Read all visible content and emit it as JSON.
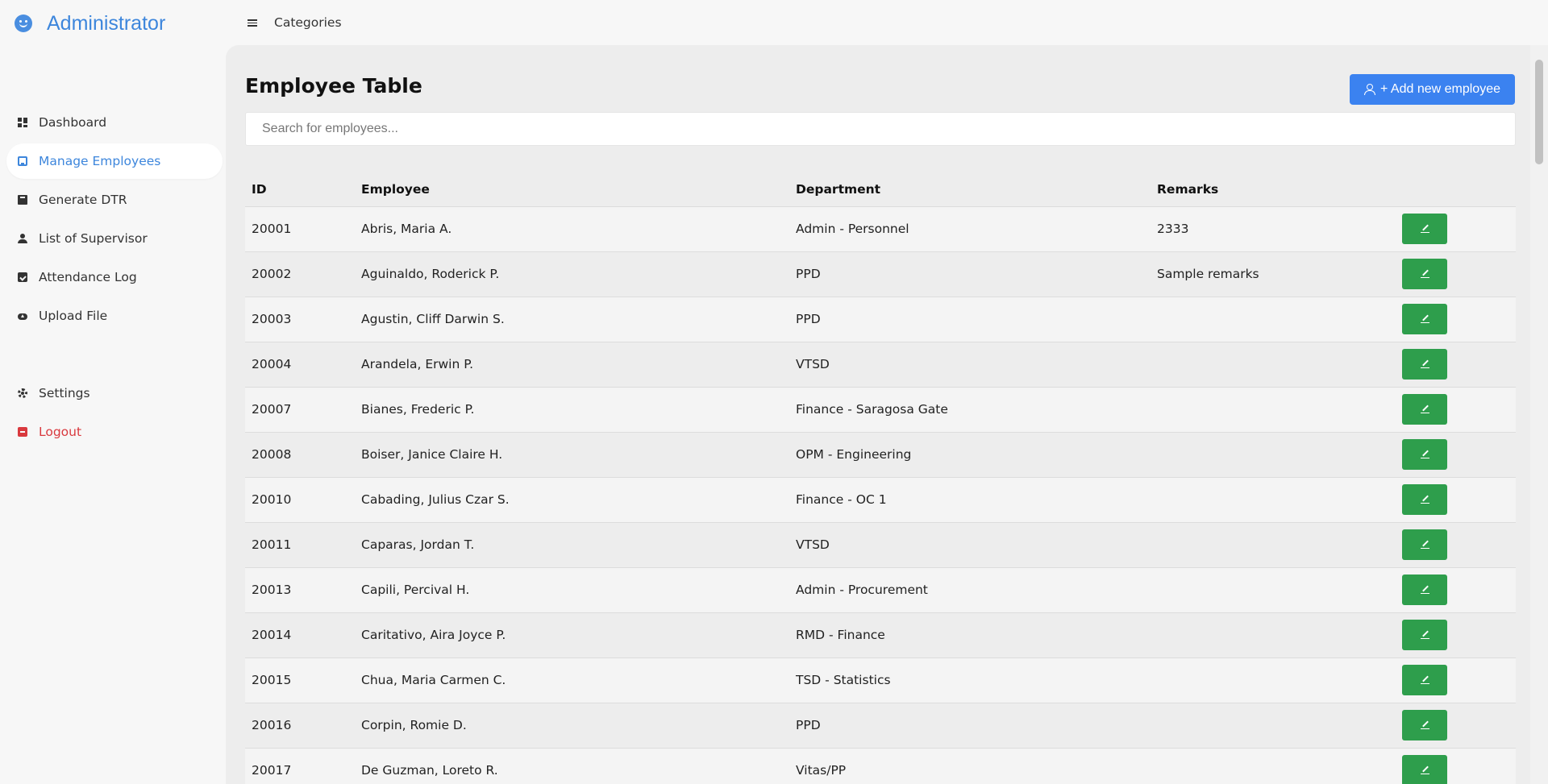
{
  "brand": {
    "title": "Administrator",
    "icon": "smiley-icon"
  },
  "topbar": {
    "title": "Categories",
    "menu_icon": "hamburger-icon"
  },
  "sidebar": {
    "items": [
      {
        "label": "Dashboard",
        "icon": "dashboard-icon",
        "active": false
      },
      {
        "label": "Manage Employees",
        "icon": "manage-employees-icon",
        "active": true
      },
      {
        "label": "Generate DTR",
        "icon": "book-icon",
        "active": false
      },
      {
        "label": "List of Supervisor",
        "icon": "user-icon",
        "active": false
      },
      {
        "label": "Attendance Log",
        "icon": "calendar-check-icon",
        "active": false
      },
      {
        "label": "Upload File",
        "icon": "cloud-upload-icon",
        "active": false
      }
    ],
    "bottom_items": [
      {
        "label": "Settings",
        "icon": "gear-icon"
      },
      {
        "label": "Logout",
        "icon": "logout-icon"
      }
    ]
  },
  "main": {
    "title": "Employee Table",
    "add_button_label": "+ Add new employee",
    "search_placeholder": "Search for employees...",
    "columns": [
      "ID",
      "Employee",
      "Department",
      "Remarks",
      ""
    ],
    "rows": [
      {
        "id": "20001",
        "employee": "Abris, Maria A.",
        "department": "Admin - Personnel",
        "remarks": "2333"
      },
      {
        "id": "20002",
        "employee": "Aguinaldo, Roderick P.",
        "department": "PPD",
        "remarks": "Sample remarks"
      },
      {
        "id": "20003",
        "employee": "Agustin, Cliff Darwin S.",
        "department": "PPD",
        "remarks": ""
      },
      {
        "id": "20004",
        "employee": "Arandela, Erwin P.",
        "department": "VTSD",
        "remarks": ""
      },
      {
        "id": "20007",
        "employee": "Bianes, Frederic P.",
        "department": "Finance - Saragosa Gate",
        "remarks": ""
      },
      {
        "id": "20008",
        "employee": "Boiser, Janice Claire H.",
        "department": "OPM - Engineering",
        "remarks": ""
      },
      {
        "id": "20010",
        "employee": "Cabading, Julius Czar S.",
        "department": "Finance - OC 1",
        "remarks": ""
      },
      {
        "id": "20011",
        "employee": "Caparas, Jordan T.",
        "department": "VTSD",
        "remarks": ""
      },
      {
        "id": "20013",
        "employee": "Capili, Percival H.",
        "department": "Admin - Procurement",
        "remarks": ""
      },
      {
        "id": "20014",
        "employee": "Caritativo, Aira Joyce P.",
        "department": "RMD - Finance",
        "remarks": ""
      },
      {
        "id": "20015",
        "employee": "Chua, Maria Carmen C.",
        "department": "TSD - Statistics",
        "remarks": ""
      },
      {
        "id": "20016",
        "employee": "Corpin, Romie D.",
        "department": "PPD",
        "remarks": ""
      },
      {
        "id": "20017",
        "employee": "De Guzman, Loreto R.",
        "department": "Vitas/PP",
        "remarks": ""
      }
    ]
  },
  "colors": {
    "accent": "#3d86dc",
    "add_button": "#3b82f0",
    "edit_button": "#2e9e4c",
    "logout": "#d9393e"
  }
}
